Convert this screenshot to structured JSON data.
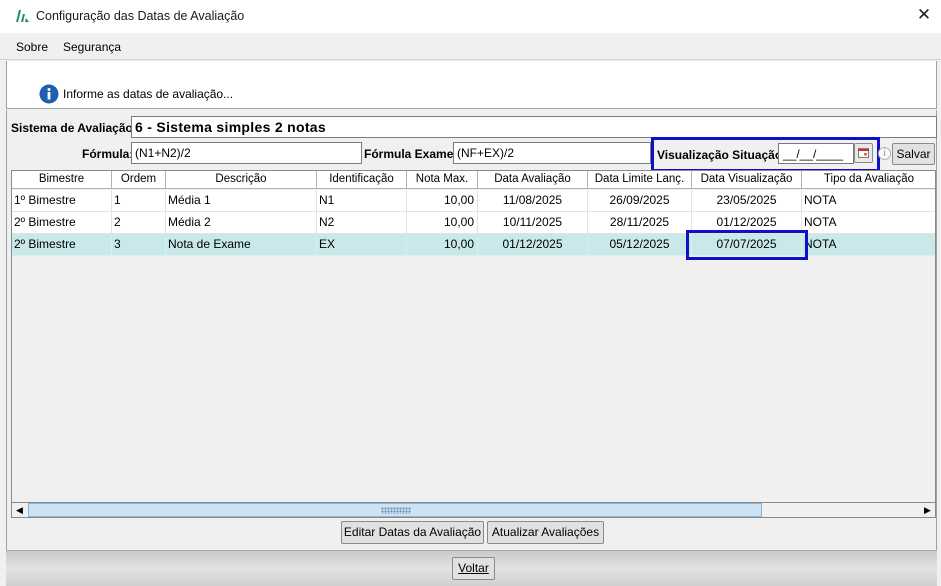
{
  "window": {
    "title": "Configuração das Datas de Avaliação",
    "close_label": "✕"
  },
  "menu": {
    "items": [
      "Sobre",
      "Segurança"
    ]
  },
  "info": {
    "message": "Informe as datas de avaliação..."
  },
  "form": {
    "sistema_label": "Sistema de Avaliação:",
    "sistema_value": "6 - Sistema simples 2 notas",
    "formula_label": "Fórmula:",
    "formula_value": "(N1+N2)/2",
    "formula_exame_label": "Fórmula Exame:",
    "formula_exame_value": "(NF+EX)/2",
    "visualizacao_label": "Visualização Situação:",
    "visualizacao_value": "__/__/____",
    "salvar_label": "Salvar"
  },
  "table": {
    "columns": [
      "Bimestre",
      "Ordem",
      "Descrição",
      "Identificação",
      "Nota Max.",
      "Data Avaliação",
      "Data Limite Lanç.",
      "Data Visualização",
      "Tipo da Avaliação"
    ],
    "rows": [
      [
        "1º Bimestre",
        "1",
        "Média 1",
        "N1",
        "10,00",
        "11/08/2025",
        "26/09/2025",
        "23/05/2025",
        "NOTA"
      ],
      [
        "2º Bimestre",
        "2",
        "Média 2",
        "N2",
        "10,00",
        "10/11/2025",
        "28/11/2025",
        "01/12/2025",
        "NOTA"
      ],
      [
        "2º Bimestre",
        "3",
        "Nota de Exame",
        "EX",
        "10,00",
        "01/12/2025",
        "05/12/2025",
        "07/07/2025",
        "NOTA"
      ]
    ],
    "selected_row": 3
  },
  "buttons": {
    "editar": "Editar Datas da Avaliação",
    "atualizar": "Atualizar Avaliações",
    "voltar": "Voltar"
  },
  "colors": {
    "highlight": "#1010c8",
    "selected_row": "#c8e8ea",
    "logo": "#1f8a70",
    "info_icon": "#1e5fb0"
  }
}
